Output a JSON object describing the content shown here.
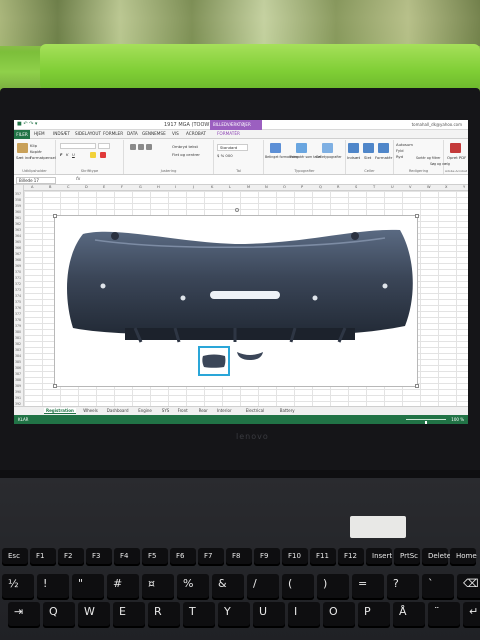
{
  "excel": {
    "window_title": "1917 MGA (TOOW) - Excel",
    "user": "tomahall_dk@yahoo.com",
    "context_band": "BILLEDVÆRKTØJER",
    "tabs": [
      "FILER",
      "HJEM",
      "INDSÆT",
      "SIDELAYOUT",
      "FORMLER",
      "DATA",
      "GENNEMSE",
      "VIS",
      "ACROBAT",
      "FORMATÉR"
    ],
    "ribbon": {
      "clipboard": {
        "paste": "Sæt ind",
        "cut": "Klip",
        "copy": "Kopiér",
        "painter": "Formatpensel",
        "label": "Udklipsholder"
      },
      "font": {
        "label": "Skrifttype"
      },
      "alignment": {
        "wrap": "Ombryd tekst",
        "merge": "Flet og centrer",
        "label": "Justering"
      },
      "number": {
        "format": "Standard",
        "label": "Tal"
      },
      "styles": {
        "conditional": "Betinget formatering",
        "table": "Formatér som tabel",
        "cell": "Celletypografier",
        "label": "Typografier"
      },
      "cells": {
        "insert": "Indsæt",
        "delete": "Slet",
        "format": "Formatér",
        "label": "Celler"
      },
      "editing": {
        "autosum": "Autosum",
        "fill": "Fyld",
        "clear": "Ryd",
        "sort": "Sortér og filtrer",
        "find": "Søg og vælg",
        "label": "Redigering"
      },
      "acrobat": {
        "create": "Opret PDF",
        "label": "Adobe Acrobat"
      }
    },
    "name_box": "Billede 17",
    "formula_symbol": "fx",
    "columns": [
      "A",
      "B",
      "C",
      "D",
      "E",
      "F",
      "G",
      "H",
      "I",
      "J",
      "K",
      "L",
      "M",
      "N",
      "O",
      "P",
      "Q",
      "R",
      "S",
      "T",
      "U",
      "V",
      "W",
      "X",
      "Y"
    ],
    "rows": [
      "357",
      "358",
      "359",
      "360",
      "361",
      "362",
      "363",
      "364",
      "365",
      "366",
      "367",
      "368",
      "369",
      "370",
      "371",
      "372",
      "373",
      "374",
      "375",
      "376",
      "377",
      "378",
      "379",
      "380",
      "381",
      "382",
      "383",
      "384",
      "385",
      "386",
      "387",
      "388",
      "389",
      "390",
      "391",
      "392"
    ],
    "sheet_tabs": [
      "Registration",
      "Wheels",
      "Dashboard",
      "Engine",
      "SYS",
      "Front",
      "Rear",
      "Interior",
      "Electrical",
      "Battery"
    ],
    "active_sheet": "Registration",
    "status": "KLAR",
    "zoom": 100,
    "zoom_label": "100 %"
  },
  "laptop": {
    "brand": "lenovo"
  },
  "keyboard": {
    "rows": [
      [
        "Esc",
        "F1",
        "F2",
        "F3",
        "F4",
        "F5",
        "F6",
        "F7",
        "F8",
        "F9",
        "F10",
        "F11",
        "F12",
        "Insert",
        "PrtSc",
        "Delete",
        "Home"
      ],
      [
        "½",
        "!",
        "\"",
        "#",
        "¤",
        "%",
        "&",
        "/",
        "(",
        ")",
        "=",
        "?",
        "`",
        "⌫"
      ],
      [
        "⇥",
        "Q",
        "W",
        "E",
        "R",
        "T",
        "Y",
        "U",
        "I",
        "O",
        "P",
        "Å",
        "¨",
        "↵"
      ]
    ]
  },
  "colors": {
    "excel_green": "#217346",
    "picture_tools": "#9b5fc0",
    "selection": "#2aa6d8",
    "bumper": "#3b4658"
  }
}
